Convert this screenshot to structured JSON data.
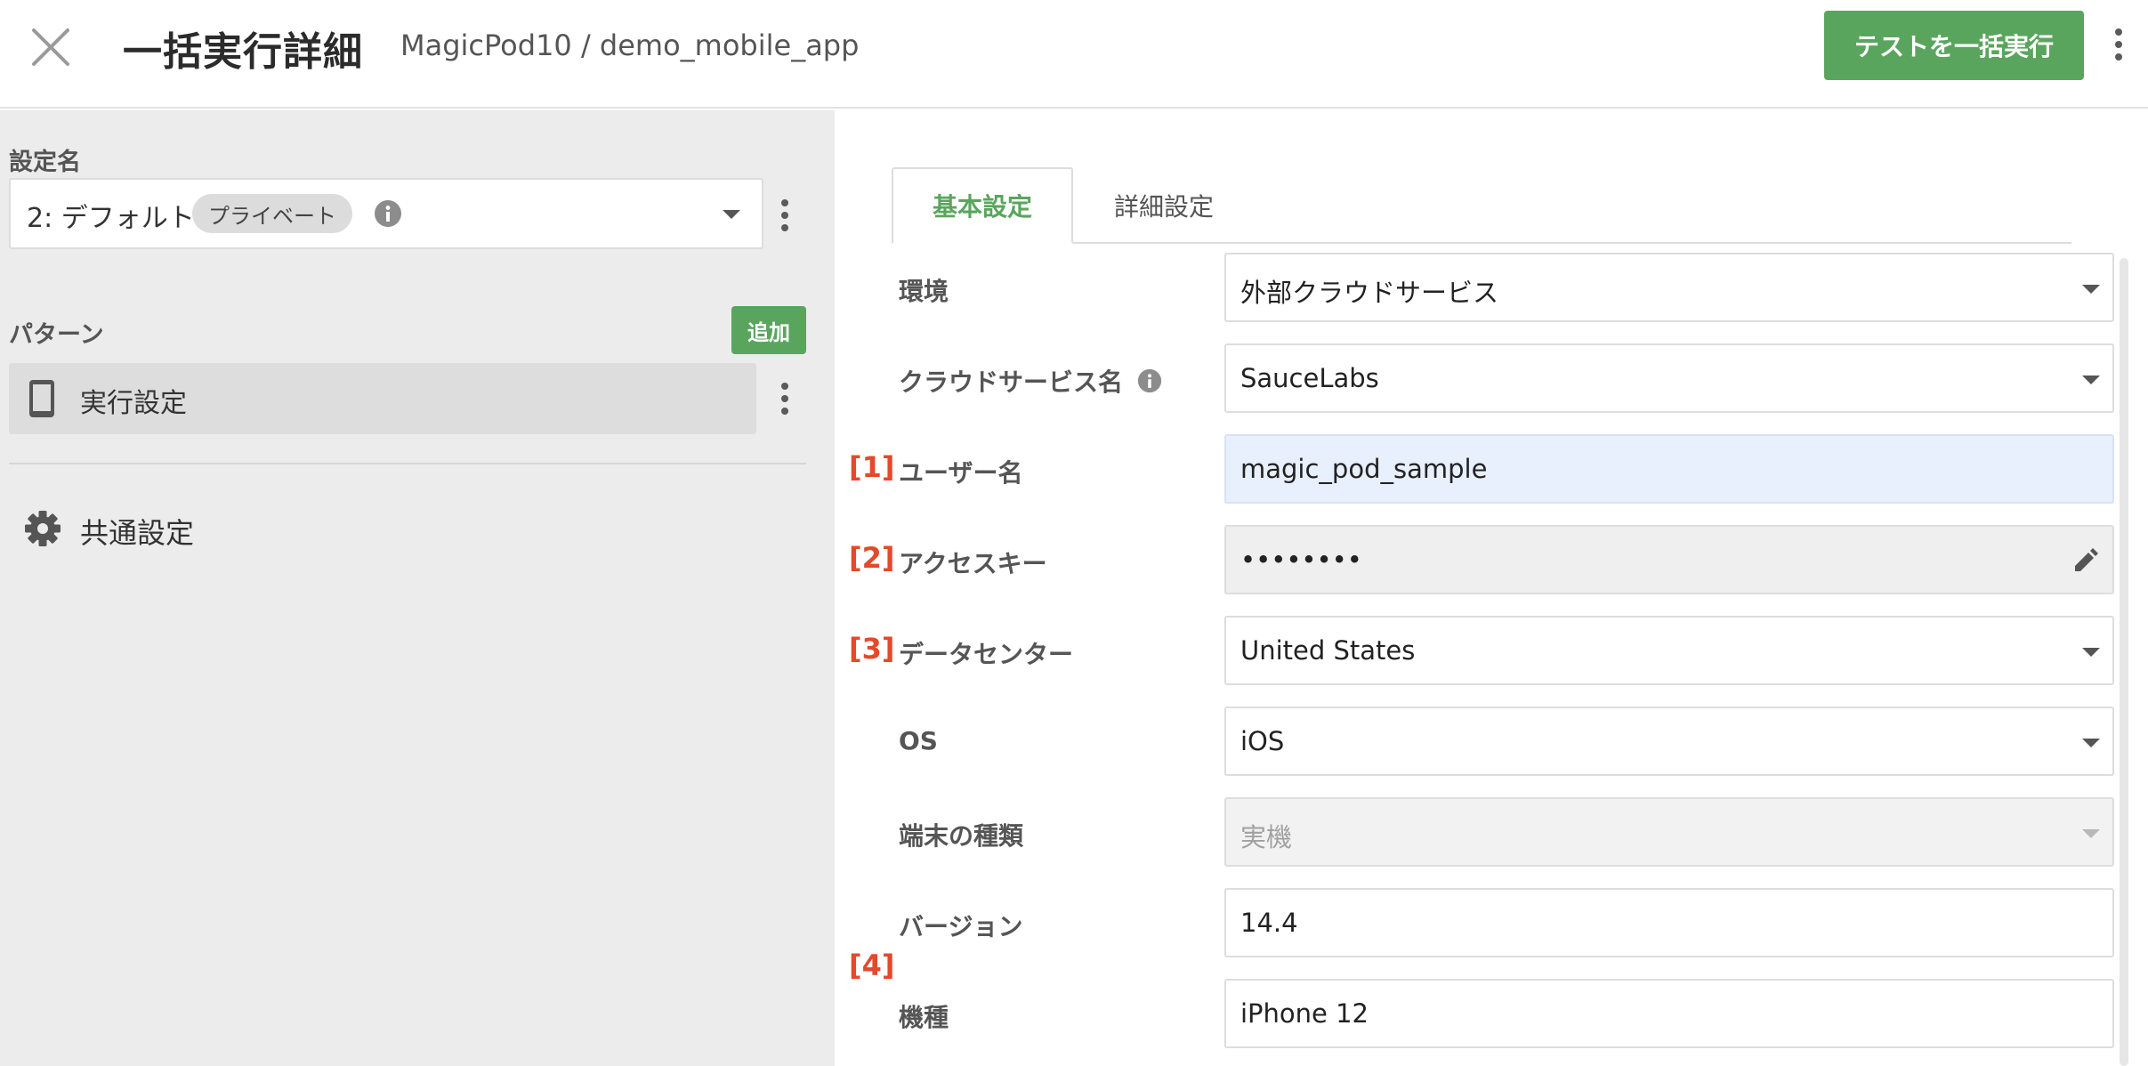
{
  "header": {
    "title": "一括実行詳細",
    "breadcrumb": "MagicPod10 / demo_mobile_app",
    "run_button": "テストを一括実行"
  },
  "sidebar": {
    "setting_name_label": "設定名",
    "setting_value": "2: デフォルト",
    "setting_badge": "プライベート",
    "pattern_label": "パターン",
    "add_button": "追加",
    "pattern_item": "実行設定",
    "common_settings": "共通設定"
  },
  "tabs": {
    "basic": "基本設定",
    "detail": "詳細設定"
  },
  "form": {
    "environment": {
      "label": "環境",
      "value": "外部クラウドサービス"
    },
    "cloud_service": {
      "label": "クラウドサービス名",
      "value": "SauceLabs"
    },
    "username": {
      "marker": "[1]",
      "label": "ユーザー名",
      "value": "magic_pod_sample"
    },
    "access_key": {
      "marker": "[2]",
      "label": "アクセスキー",
      "value": "••••••••"
    },
    "data_center": {
      "marker": "[3]",
      "label": "データセンター",
      "value": "United States"
    },
    "os": {
      "label": "OS",
      "value": "iOS"
    },
    "device_type": {
      "label": "端末の種類",
      "value": "実機"
    },
    "version": {
      "label": "バージョン",
      "value": "14.4"
    },
    "model": {
      "label": "機種",
      "value": "iPhone 12"
    },
    "marker_4": "[4]"
  },
  "colors": {
    "accent_green": "#5aa55e",
    "marker_red": "#e24a2b",
    "sidebar_bg": "#ececec",
    "highlight_field": "#e8f0fe"
  },
  "icons": [
    "close-icon",
    "kebab-menu-icon",
    "info-icon",
    "chevron-down-icon",
    "phone-icon",
    "gear-icon",
    "pencil-icon"
  ]
}
